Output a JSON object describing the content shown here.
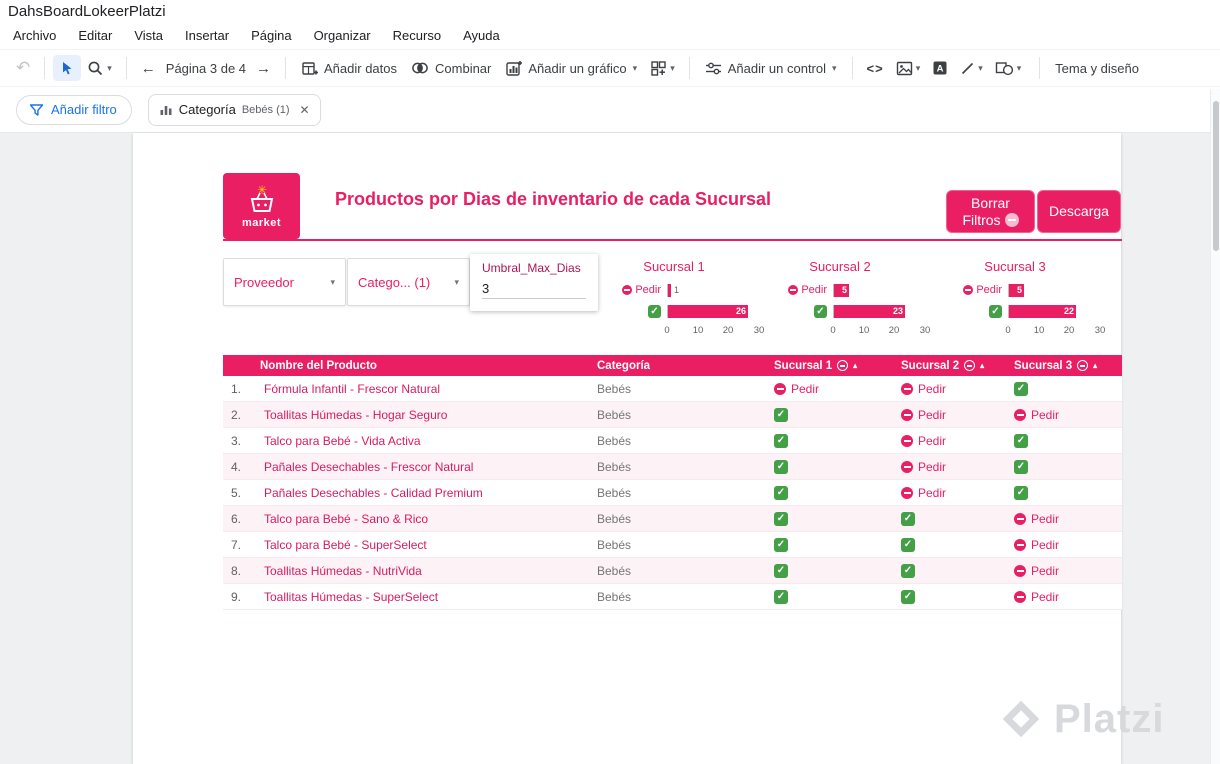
{
  "colors": {
    "accent": "#e91e63",
    "green": "#43a047",
    "blue": "#1a73e8"
  },
  "icons": {
    "check": "✓",
    "close": "✕",
    "caret_down": "▾",
    "arrow_left": "←",
    "arrow_right": "→",
    "undo": "↶",
    "code": "<>",
    "sort_asc": "▴"
  },
  "window": {
    "title": "DahsBoardLokeerPlatzi"
  },
  "menubar": {
    "items": [
      "Archivo",
      "Editar",
      "Vista",
      "Insertar",
      "Página",
      "Organizar",
      "Recurso",
      "Ayuda"
    ]
  },
  "toolbar": {
    "page_nav": "Página 3 de 4",
    "add_data_label": "Añadir datos",
    "blend_label": "Combinar",
    "add_chart_label": "Añadir un gráfico",
    "add_control_label": "Añadir un control",
    "theme_label": "Tema y diseño"
  },
  "filter_bar": {
    "add_filter_label": "Añadir filtro",
    "chip_title": "Categoría",
    "chip_value": "Bebés (1)"
  },
  "dashboard": {
    "logo_text": "market",
    "title": "Productos por Dias de inventario de cada Sucursal",
    "clear_filters_label": "Borrar Filtros",
    "download_label": "Descarga",
    "controls": {
      "provider_label": "Proveedor",
      "category_label": "Catego... (1)",
      "threshold_label": "Umbral_Max_Dias",
      "threshold_value": "3"
    },
    "status_labels": {
      "pedir": "Pedir"
    },
    "charts": [
      {
        "title": "Sucursal 1",
        "pedir": 1,
        "ok": 26,
        "axis_ticks": [
          0,
          10,
          20,
          30
        ],
        "axis_max": 30
      },
      {
        "title": "Sucursal 2",
        "pedir": 5,
        "ok": 23,
        "axis_ticks": [
          0,
          10,
          20,
          30
        ],
        "axis_max": 30
      },
      {
        "title": "Sucursal 3",
        "pedir": 5,
        "ok": 22,
        "axis_ticks": [
          0,
          10,
          20,
          30
        ],
        "axis_max": 30
      }
    ],
    "table": {
      "columns": [
        "Nombre del Producto",
        "Categoría",
        "Sucursal 1",
        "Sucursal 2",
        "Sucursal 3"
      ],
      "rows": [
        {
          "idx": "1.",
          "name": "Fórmula Infantil - Frescor Natural",
          "category": "Bebés",
          "s1": "pedir",
          "s2": "pedir",
          "s3": "ok"
        },
        {
          "idx": "2.",
          "name": "Toallitas Húmedas - Hogar Seguro",
          "category": "Bebés",
          "s1": "ok",
          "s2": "pedir",
          "s3": "pedir"
        },
        {
          "idx": "3.",
          "name": "Talco para Bebé - Vida Activa",
          "category": "Bebés",
          "s1": "ok",
          "s2": "pedir",
          "s3": "ok"
        },
        {
          "idx": "4.",
          "name": "Pañales Desechables - Frescor Natural",
          "category": "Bebés",
          "s1": "ok",
          "s2": "pedir",
          "s3": "ok"
        },
        {
          "idx": "5.",
          "name": "Pañales Desechables - Calidad Premium",
          "category": "Bebés",
          "s1": "ok",
          "s2": "pedir",
          "s3": "ok"
        },
        {
          "idx": "6.",
          "name": "Talco para Bebé - Sano & Rico",
          "category": "Bebés",
          "s1": "ok",
          "s2": "ok",
          "s3": "pedir"
        },
        {
          "idx": "7.",
          "name": "Talco para Bebé - SuperSelect",
          "category": "Bebés",
          "s1": "ok",
          "s2": "ok",
          "s3": "pedir"
        },
        {
          "idx": "8.",
          "name": "Toallitas Húmedas - NutriVida",
          "category": "Bebés",
          "s1": "ok",
          "s2": "ok",
          "s3": "pedir"
        },
        {
          "idx": "9.",
          "name": "Toallitas Húmedas - SuperSelect",
          "category": "Bebés",
          "s1": "ok",
          "s2": "ok",
          "s3": "pedir"
        }
      ]
    }
  },
  "watermark": {
    "text": "Platzi"
  }
}
